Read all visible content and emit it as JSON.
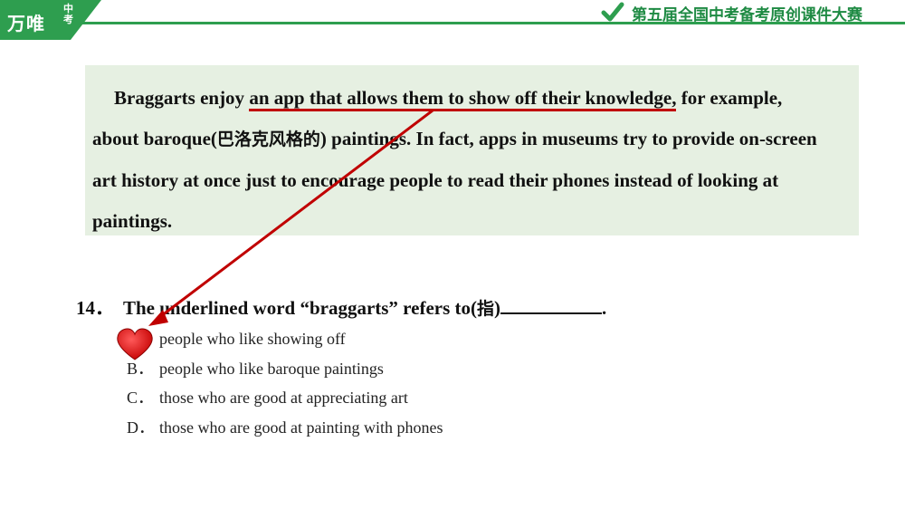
{
  "header": {
    "logo_main": "万唯",
    "logo_small": "中考",
    "contest_title": "第五届全国中考备考原创课件大赛",
    "colors": {
      "brand_green": "#2e9e4f",
      "title_green": "#1e8a43"
    }
  },
  "passage": {
    "part1": "Braggarts enjoy ",
    "underlined": "an app that allows them to show off their knowledge,",
    "part2": " for example, about baroque(",
    "zh_gloss": "巴洛克风格的",
    "part3": ") paintings. In fact, apps in museums try to provide on-screen art history at once just to encourage people to read their phones instead of looking at paintings.",
    "colors": {
      "background": "#e6f0e2",
      "underline": "#c00000"
    }
  },
  "question": {
    "number": "14．",
    "text_before": "The underlined word “braggarts” refers to(",
    "zh_hint": "指",
    "text_after": ")",
    "end": "."
  },
  "options": [
    {
      "letter": "A．",
      "text": "people who like showing off"
    },
    {
      "letter": "B．",
      "text": "people who like baroque paintings"
    },
    {
      "letter": "C．",
      "text": "those who are good at appreciating art"
    },
    {
      "letter": "D．",
      "text": "those who are good at painting with phones"
    }
  ],
  "annotations": {
    "selected_option": "A",
    "marker_icon": "heart-icon",
    "arrow_color": "#c00000"
  }
}
